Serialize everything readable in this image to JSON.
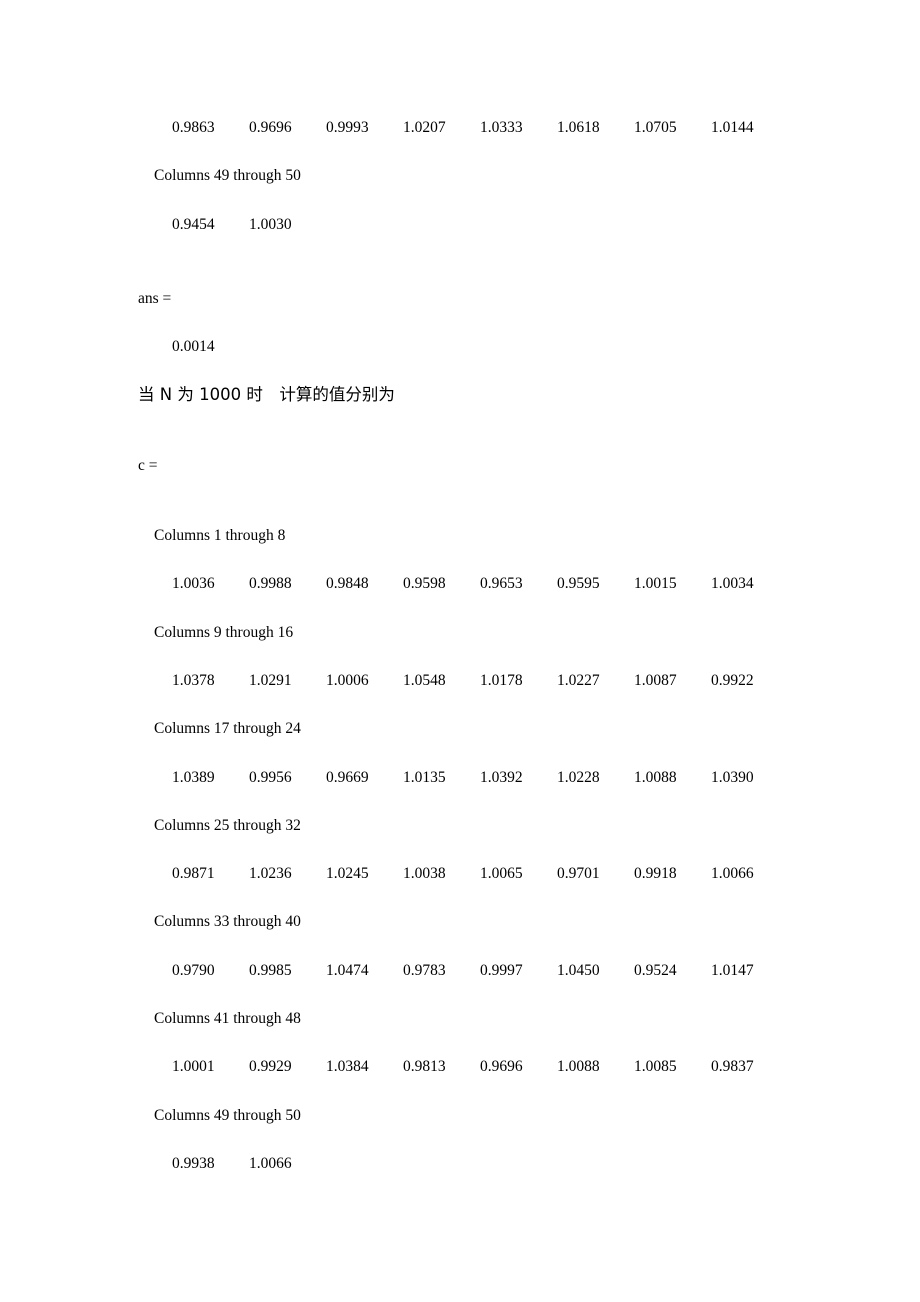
{
  "document": {
    "page_background": "#ffffff",
    "text_color": "#000000"
  },
  "section_previous": {
    "tail_values": [
      "0.9863",
      "0.9696",
      "0.9993",
      "1.0207",
      "1.0333",
      "1.0618",
      "1.0705",
      "1.0144"
    ],
    "tail_header": "Columns 49 through 50",
    "tail_last_values": [
      "0.9454",
      "1.0030"
    ],
    "ans_label": "ans =",
    "ans_value": "0.0014"
  },
  "note": {
    "text": "当 N 为 1000 时　计算的值分别为"
  },
  "section_current": {
    "variable_label": "c =",
    "blocks": [
      {
        "header": "Columns 1 through 8",
        "values": [
          "1.0036",
          "0.9988",
          "0.9848",
          "0.9598",
          "0.9653",
          "0.9595",
          "1.0015",
          "1.0034"
        ]
      },
      {
        "header": "Columns 9 through 16",
        "values": [
          "1.0378",
          "1.0291",
          "1.0006",
          "1.0548",
          "1.0178",
          "1.0227",
          "1.0087",
          "0.9922"
        ]
      },
      {
        "header": "Columns 17 through 24",
        "values": [
          "1.0389",
          "0.9956",
          "0.9669",
          "1.0135",
          "1.0392",
          "1.0228",
          "1.0088",
          "1.0390"
        ]
      },
      {
        "header": "Columns 25 through 32",
        "values": [
          "0.9871",
          "1.0236",
          "1.0245",
          "1.0038",
          "1.0065",
          "0.9701",
          "0.9918",
          "1.0066"
        ]
      },
      {
        "header": "Columns 33 through 40",
        "values": [
          "0.9790",
          "0.9985",
          "1.0474",
          "0.9783",
          "0.9997",
          "1.0450",
          "0.9524",
          "1.0147"
        ]
      },
      {
        "header": "Columns 41 through 48",
        "values": [
          "1.0001",
          "0.9929",
          "1.0384",
          "0.9813",
          "0.9696",
          "1.0088",
          "1.0085",
          "0.9837"
        ]
      },
      {
        "header": "Columns 49 through 50",
        "values": [
          "0.9938",
          "1.0066"
        ]
      }
    ]
  }
}
